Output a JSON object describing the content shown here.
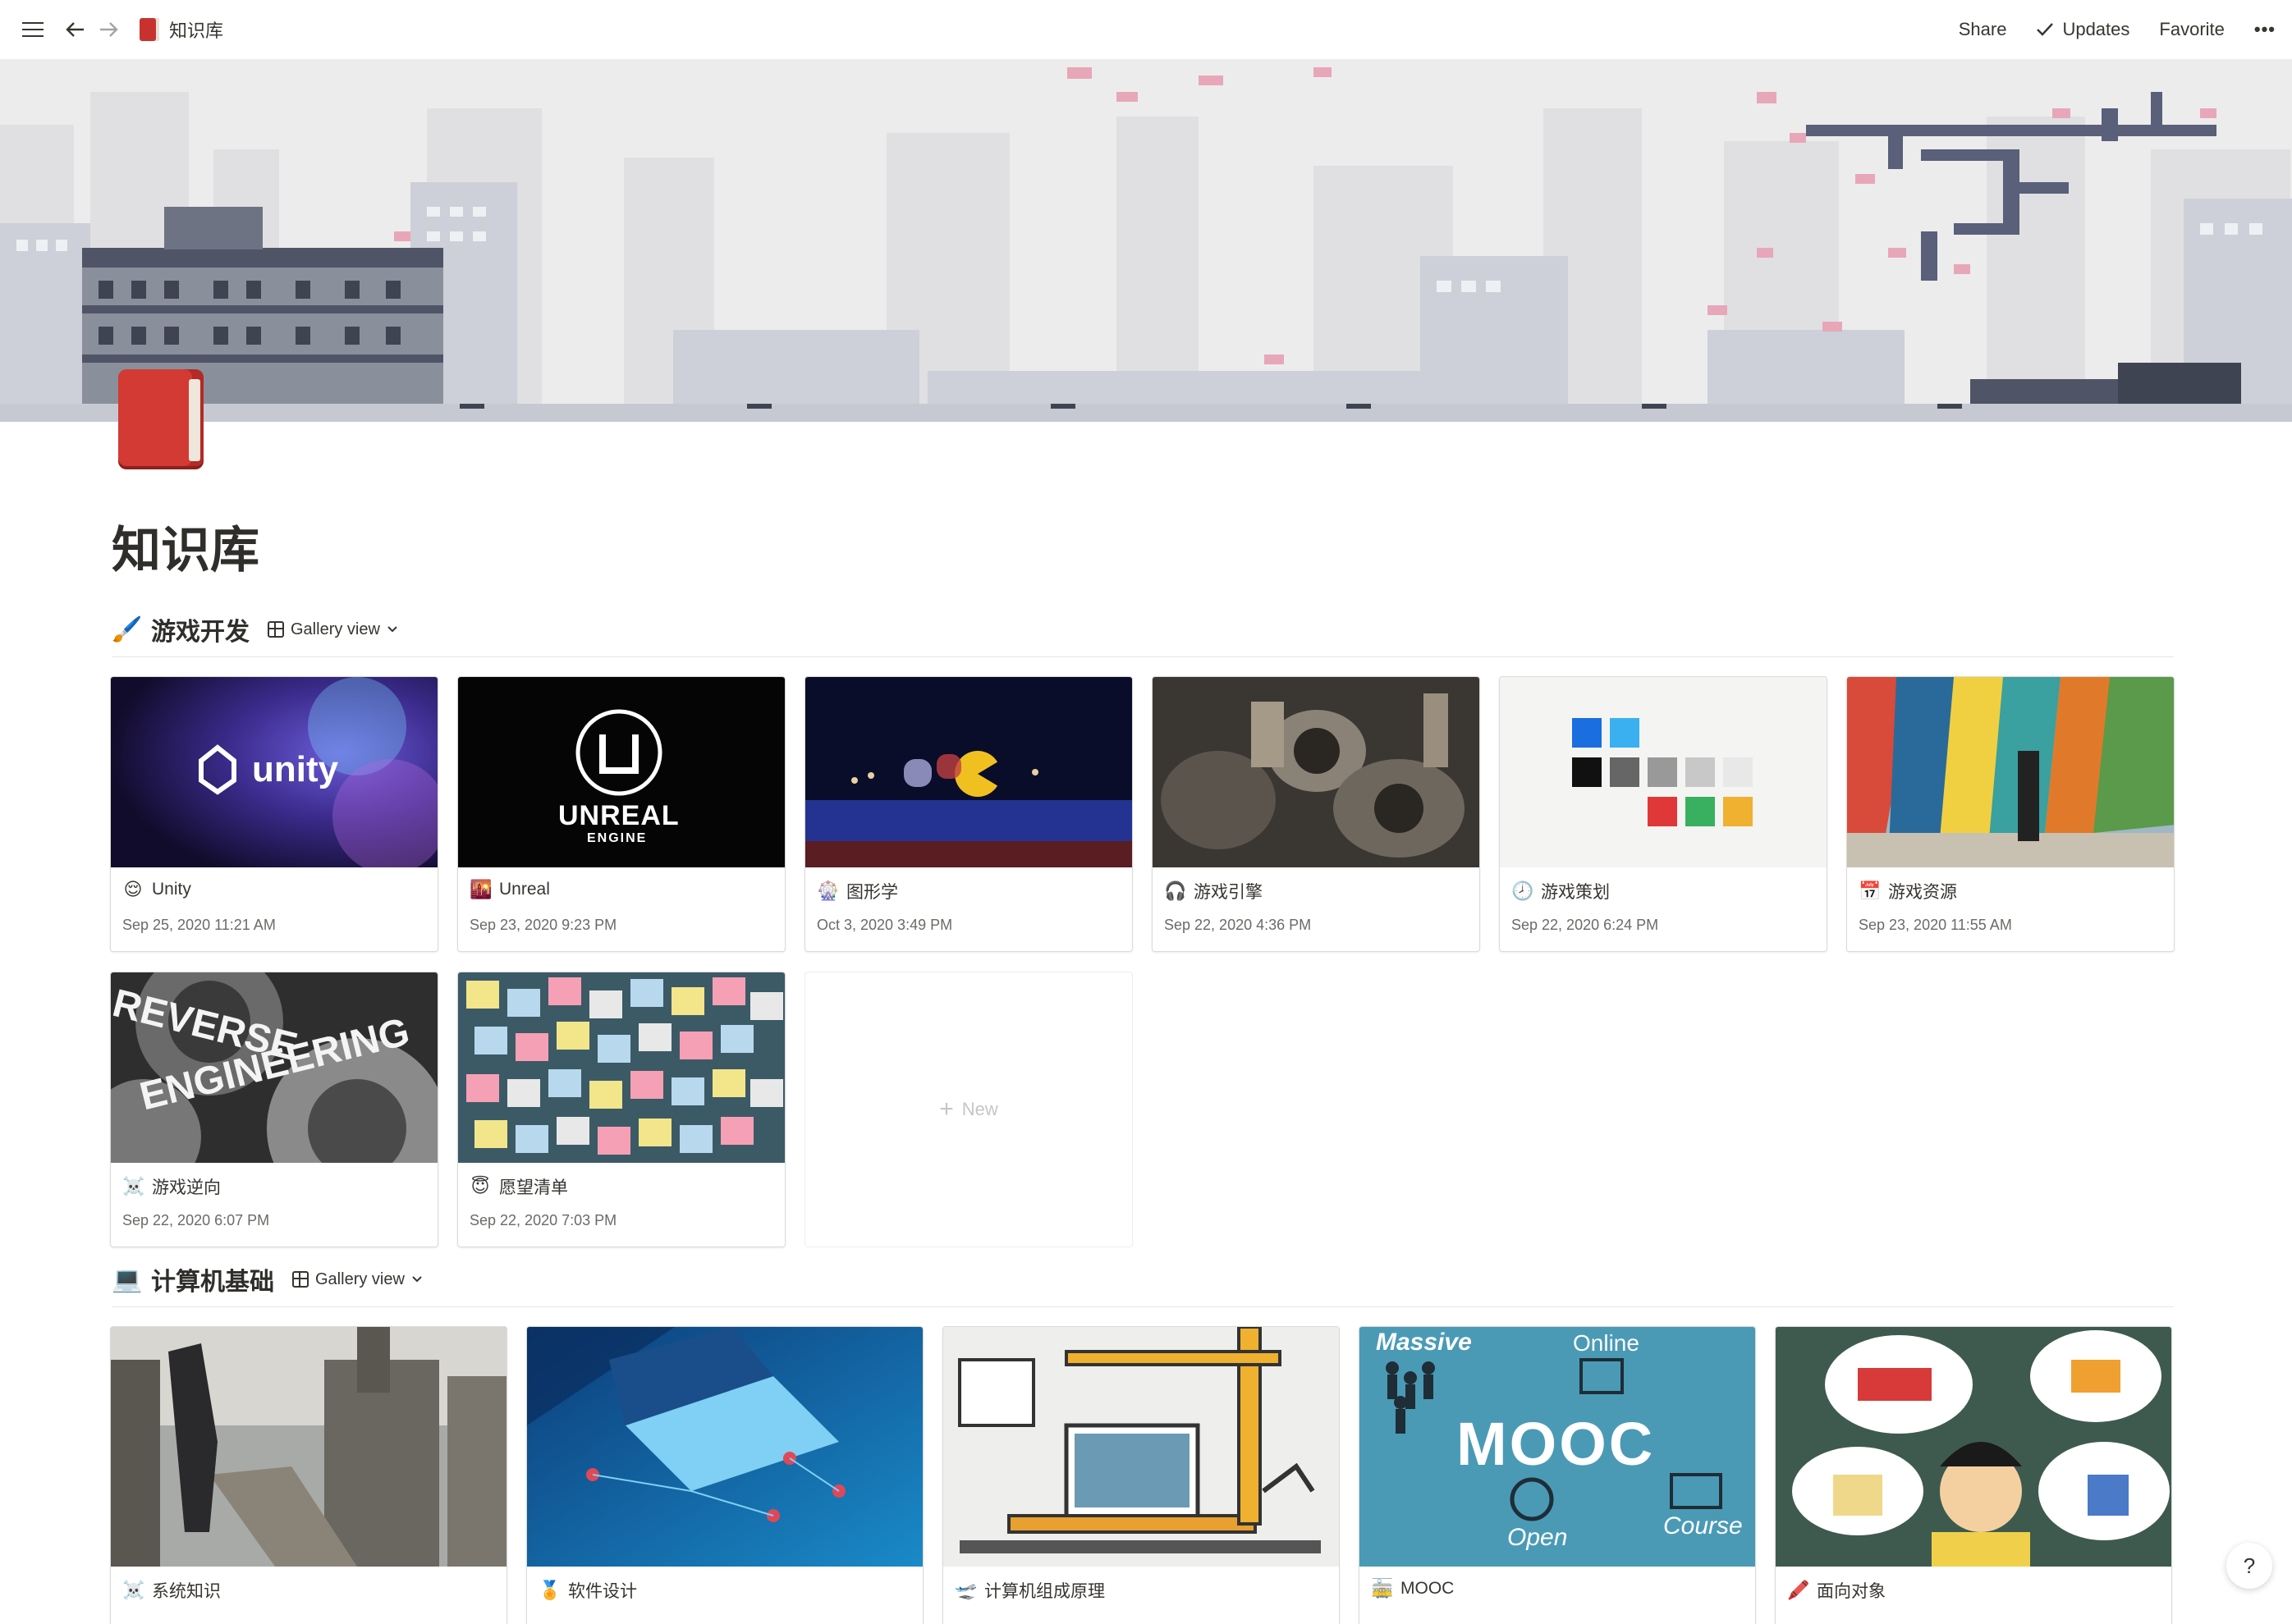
{
  "topbar": {
    "breadcrumb": "知识库",
    "share": "Share",
    "updates": "Updates",
    "favorite": "Favorite",
    "more": "•••"
  },
  "page": {
    "title": "知识库"
  },
  "sections": [
    {
      "icon": "🖌️",
      "title": "游戏开发",
      "view": "Gallery view",
      "cards": [
        {
          "emoji": "😌",
          "name": "Unity",
          "date": "Sep 25, 2020 11:21 AM"
        },
        {
          "emoji": "🌇",
          "name": "Unreal",
          "date": "Sep 23, 2020 9:23 PM"
        },
        {
          "emoji": "🎡",
          "name": "图形学",
          "date": "Oct 3, 2020 3:49 PM"
        },
        {
          "emoji": "🎧",
          "name": "游戏引擎",
          "date": "Sep 22, 2020 4:36 PM"
        },
        {
          "emoji": "🕗",
          "name": "游戏策划",
          "date": "Sep 22, 2020 6:24 PM"
        },
        {
          "emoji": "📅",
          "name": "游戏资源",
          "date": "Sep 23, 2020 11:55 AM"
        },
        {
          "emoji": "☠️",
          "name": "游戏逆向",
          "date": "Sep 22, 2020 6:07 PM"
        },
        {
          "emoji": "😇",
          "name": "愿望清单",
          "date": "Sep 22, 2020 7:03 PM"
        }
      ],
      "new_label": "New"
    },
    {
      "icon": "💻",
      "title": "计算机基础",
      "view": "Gallery view",
      "cards": [
        {
          "emoji": "☠️",
          "name": "系统知识"
        },
        {
          "emoji": "🏅",
          "name": "软件设计"
        },
        {
          "emoji": "🛫",
          "name": "计算机组成原理"
        },
        {
          "emoji": "🚋",
          "name": "MOOC"
        },
        {
          "emoji": "🖍️",
          "name": "面向对象"
        }
      ]
    }
  ],
  "cover_text": {
    "unity": "unity",
    "unreal": "UNREAL",
    "unreal_sub": "ENGINE",
    "reverse": "REVERSE",
    "engineering": "ENGINEERING",
    "mooc_massive": "Massive",
    "mooc_online": "Online",
    "mooc_big": "MOOC",
    "mooc_open": "Open",
    "mooc_course": "Course"
  },
  "help_label": "?"
}
